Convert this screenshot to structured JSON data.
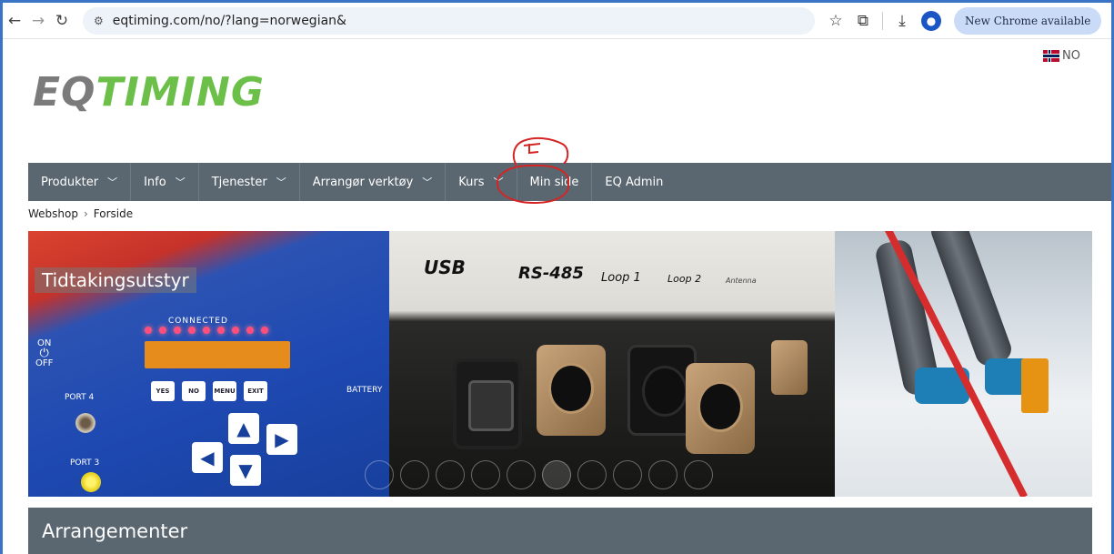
{
  "browser": {
    "url": "eqtiming.com/no/?lang=norwegian&",
    "update_label": "New Chrome available",
    "icons": [
      "back-icon",
      "forward-icon",
      "reload-icon",
      "site-info-icon",
      "bookmark-star-icon",
      "extensions-icon",
      "download-icon",
      "profile-icon"
    ]
  },
  "header": {
    "logo_eq": "EQ",
    "logo_timing": "TIMING",
    "language": "NO"
  },
  "nav": {
    "items": [
      {
        "label": "Produkter",
        "has_dropdown": true
      },
      {
        "label": "Info",
        "has_dropdown": true
      },
      {
        "label": "Tjenester",
        "has_dropdown": true
      },
      {
        "label": "Arrangør verktøy",
        "has_dropdown": true
      },
      {
        "label": "Kurs",
        "has_dropdown": true
      },
      {
        "label": "Min side",
        "has_dropdown": false
      },
      {
        "label": "EQ Admin",
        "has_dropdown": false
      }
    ]
  },
  "breadcrumb": {
    "items": [
      "Webshop",
      "Forside"
    ]
  },
  "banner": {
    "panel1_label": "Tidtakingsutstyr",
    "device": {
      "connected": "CONNECTED",
      "on": "ON",
      "off": "OFF",
      "keys": [
        "YES",
        "NO",
        "MENU",
        "EXIT"
      ],
      "port4": "PORT 4",
      "port3": "PORT 3",
      "battery": "BATTERY"
    },
    "panel2_labels": [
      "USB",
      "RS-485",
      "Loop 1",
      "Loop 2",
      "Antenna"
    ],
    "slide_count": 10,
    "active_slide": 6
  },
  "section": {
    "title": "Arrangementer"
  },
  "colors": {
    "nav_bg": "#5b6770",
    "logo_green": "#6cc04a",
    "logo_grey": "#7b7b7b",
    "annotation_red": "#d42525",
    "chrome_pill": "#c9dbf7"
  }
}
